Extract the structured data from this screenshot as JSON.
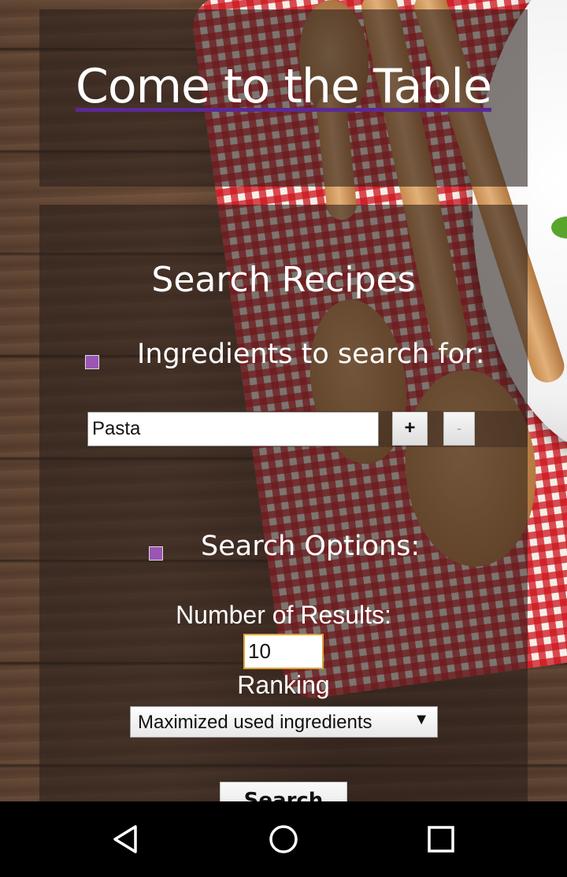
{
  "header": {
    "title": "Come to the Table"
  },
  "search": {
    "title": "Search Recipes",
    "ingredients_heading": "Ingredients to search for:",
    "ingredient_value": "Pasta",
    "add_label": "+",
    "remove_label": "-",
    "options_heading": "Search Options:",
    "results_label": "Number of Results:",
    "results_value": "10",
    "ranking_label": "Ranking",
    "ranking_selected": "Maximized used ingredients",
    "search_button_label": "Search"
  },
  "colors": {
    "bullet": "#9a55b5",
    "title_underline": "#5b2a94",
    "input_focus_border": "#e0a43a"
  },
  "navbar": {
    "icons": [
      "back-icon",
      "home-icon",
      "recents-icon"
    ]
  }
}
